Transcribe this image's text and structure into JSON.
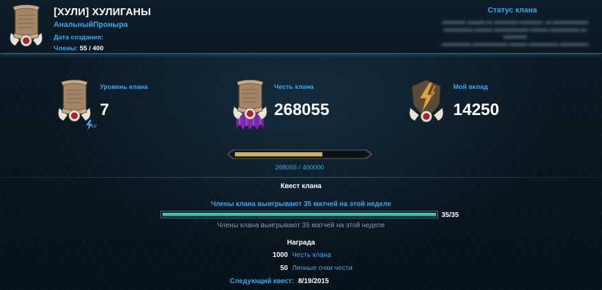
{
  "header": {
    "clan_title": "[ХУЛИ] ХУЛИГАНЫ",
    "leader_name": "АнальныйПроныра",
    "created_label": "Дата создания:",
    "members_label": "Члены:",
    "members_value": "55 / 400",
    "status_title": "Статус клана"
  },
  "stats": {
    "level": {
      "label": "Уровень клана",
      "value": "7",
      "badge": "LV"
    },
    "honor": {
      "label": "Честь клана",
      "value": "268055"
    },
    "contribution": {
      "label": "Мой вклад",
      "value": "14250"
    }
  },
  "honor_progress": {
    "text": "268055 / 400000",
    "current": 268055,
    "max": 400000
  },
  "quest": {
    "title": "Квест клана",
    "description": "Члены клана выигрывают 35 матчей на этой неделе",
    "progress_text": "35/35",
    "current": 35,
    "max": 35,
    "subtitle": "Члены клана выигрывают 35 матчей на этой неделе",
    "reward_title": "Награда",
    "rewards": [
      {
        "amount": "1000",
        "label": "Честь клана"
      },
      {
        "amount": "50",
        "label": "Личные очки чести"
      }
    ],
    "next_label": "Следующий квест:",
    "next_date": "8/19/2015"
  },
  "colors": {
    "accent_blue": "#3fa6e4",
    "progress_gold": "#c9b25a",
    "quest_teal": "#2fc2aa",
    "glow_line": "#2b6f96"
  },
  "icons": {
    "clan_crest": "parchment-crest-icon",
    "level": "parchment-crest-icon",
    "honor": "purple-banner-crest-icon",
    "contribution": "lightning-crest-icon",
    "level_badge": "lightning-lv-icon"
  }
}
